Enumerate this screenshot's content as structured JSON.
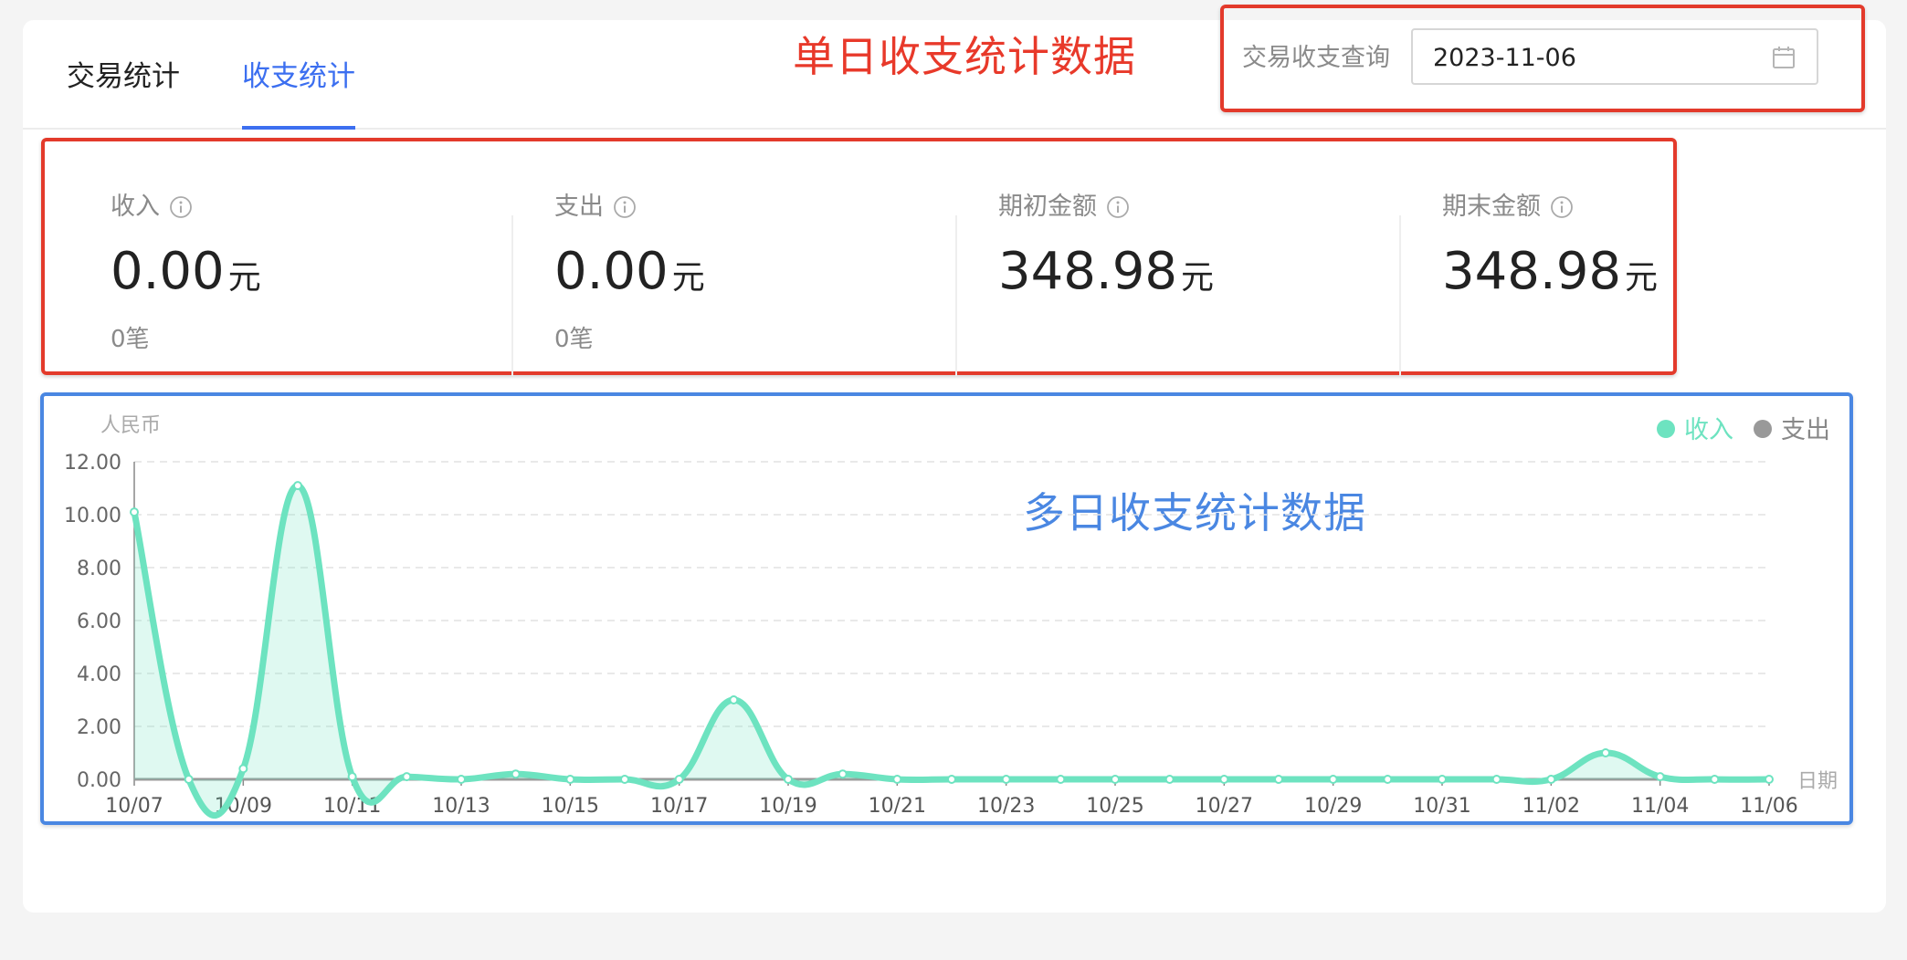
{
  "tabs": [
    {
      "label": "交易统计",
      "active": false
    },
    {
      "label": "收支统计",
      "active": true
    }
  ],
  "annotations": {
    "single_day": "单日收支统计数据",
    "multi_day": "多日收支统计数据",
    "colors": {
      "red": "#e8392a",
      "blue": "#4a87e2"
    }
  },
  "query": {
    "label": "交易收支查询",
    "date_value": "2023-11-06",
    "icon": "calendar-icon"
  },
  "stats": [
    {
      "label": "收入",
      "value": "0.00",
      "unit": "元",
      "count": "0笔",
      "icon": "info-icon"
    },
    {
      "label": "支出",
      "value": "0.00",
      "unit": "元",
      "count": "0笔",
      "icon": "info-icon"
    },
    {
      "label": "期初金额",
      "value": "348.98",
      "unit": "元",
      "count": "",
      "icon": "info-icon"
    },
    {
      "label": "期末金额",
      "value": "348.98",
      "unit": "元",
      "count": "",
      "icon": "info-icon"
    }
  ],
  "chart_data": {
    "type": "area",
    "ylabel": "人民币",
    "xlabel": "日期",
    "ylim": [
      0,
      12
    ],
    "yticks": [
      "0.00",
      "2.00",
      "4.00",
      "6.00",
      "8.00",
      "10.00",
      "12.00"
    ],
    "categories": [
      "10/07",
      "10/08",
      "10/09",
      "10/10",
      "10/11",
      "10/12",
      "10/13",
      "10/14",
      "10/15",
      "10/16",
      "10/17",
      "10/18",
      "10/19",
      "10/20",
      "10/21",
      "10/22",
      "10/23",
      "10/24",
      "10/25",
      "10/26",
      "10/27",
      "10/28",
      "10/29",
      "10/30",
      "10/31",
      "11/01",
      "11/02",
      "11/03",
      "11/04",
      "11/05",
      "11/06"
    ],
    "xtick_labels": [
      "10/07",
      "10/09",
      "10/11",
      "10/13",
      "10/15",
      "10/17",
      "10/19",
      "10/21",
      "10/23",
      "10/25",
      "10/27",
      "10/29",
      "10/31",
      "11/02",
      "11/04",
      "11/06"
    ],
    "series": [
      {
        "name": "收入",
        "color": "#6de3c0",
        "values": [
          10.1,
          0,
          0.4,
          11.1,
          0.1,
          0.1,
          0,
          0.2,
          0,
          0,
          0,
          3.0,
          0,
          0.2,
          0,
          0,
          0,
          0,
          0,
          0,
          0,
          0,
          0,
          0,
          0,
          0,
          0,
          1.0,
          0.1,
          0,
          0
        ]
      },
      {
        "name": "支出",
        "color": "#999999",
        "values": [
          0,
          0,
          0,
          0,
          0,
          0,
          0,
          0,
          0,
          0,
          0,
          0,
          0,
          0,
          0,
          0,
          0,
          0,
          0,
          0,
          0,
          0,
          0,
          0,
          0,
          0,
          0,
          0,
          0,
          0,
          0
        ]
      }
    ],
    "grid": true,
    "legend": "top-right"
  }
}
